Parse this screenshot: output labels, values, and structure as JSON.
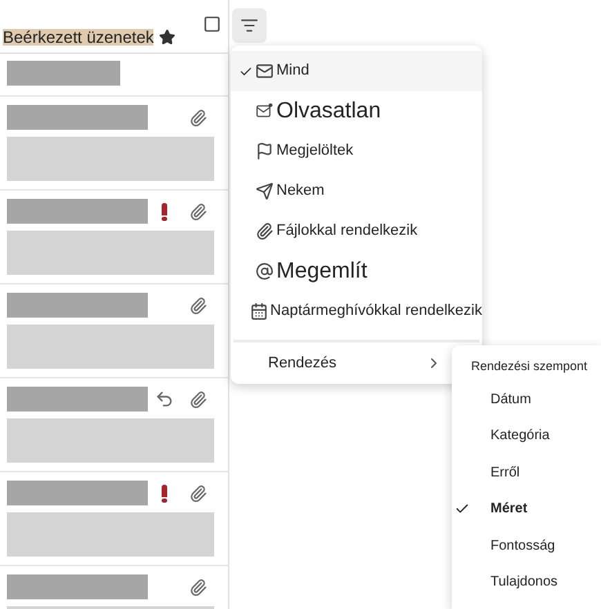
{
  "header": {
    "title": "Beérkezett üzenetek",
    "favorite": true
  },
  "messages": [
    {
      "attachment": true,
      "important": false,
      "replied": false
    },
    {
      "attachment": true,
      "important": true,
      "replied": false
    },
    {
      "attachment": true,
      "important": false,
      "replied": false
    },
    {
      "attachment": true,
      "important": false,
      "replied": true
    },
    {
      "attachment": true,
      "important": true,
      "replied": false
    },
    {
      "attachment": true,
      "important": false,
      "replied": false
    }
  ],
  "filter_menu": {
    "items": [
      {
        "label": "Mind",
        "selected": true
      },
      {
        "label": "Olvasatlan",
        "selected": false
      },
      {
        "label": "Megjelöltek",
        "selected": false
      },
      {
        "label": "Nekem",
        "selected": false
      },
      {
        "label": "Fájlokkal rendelkezik",
        "selected": false
      },
      {
        "label": "Megemlít",
        "selected": false
      },
      {
        "label": "Naptármeghívókkal rendelkezik",
        "selected": false
      }
    ],
    "sort": {
      "label": "Rendezés"
    }
  },
  "sort_menu": {
    "heading": "Rendezési szempont",
    "items": [
      {
        "label": "Dátum",
        "selected": false
      },
      {
        "label": "Kategória",
        "selected": false
      },
      {
        "label": "Erről",
        "selected": false
      },
      {
        "label": "Méret",
        "selected": true
      },
      {
        "label": "Fontosság",
        "selected": false
      },
      {
        "label": "Tulajdonos",
        "selected": false
      }
    ]
  }
}
